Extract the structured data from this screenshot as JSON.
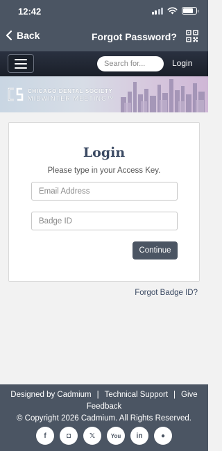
{
  "status_bar": {
    "time": "12:42",
    "battery_level": 0.78
  },
  "nav": {
    "back_label": "Back",
    "title": "Forgot Password?"
  },
  "topbar": {
    "search_placeholder": "Search for...",
    "login_label": "Login"
  },
  "banner": {
    "line1": "CHICAGO DENTAL SOCIETY",
    "line2": "MIDWINTER MEETING™"
  },
  "login_card": {
    "title": "Login",
    "subtitle": "Please type in your Access Key.",
    "email_placeholder": "Email Address",
    "badge_placeholder": "Badge ID",
    "continue_label": "Continue"
  },
  "forgot_badge_label": "Forgot Badge ID?",
  "footer": {
    "designed_by": "Designed by Cadmium",
    "separator": "|",
    "technical_support": "Technical Support",
    "give_feedback": "Give Feedback",
    "copyright": "© Copyright 2026 Cadmium. All Rights Reserved.",
    "socials": [
      {
        "icon": "facebook-icon",
        "glyph": "f"
      },
      {
        "icon": "instagram-icon",
        "glyph": "◘"
      },
      {
        "icon": "x-icon",
        "glyph": "𝕏"
      },
      {
        "icon": "youtube-icon",
        "glyph": "You"
      },
      {
        "icon": "linkedin-icon",
        "glyph": "in"
      },
      {
        "icon": "other-social-icon",
        "glyph": "●"
      }
    ]
  }
}
